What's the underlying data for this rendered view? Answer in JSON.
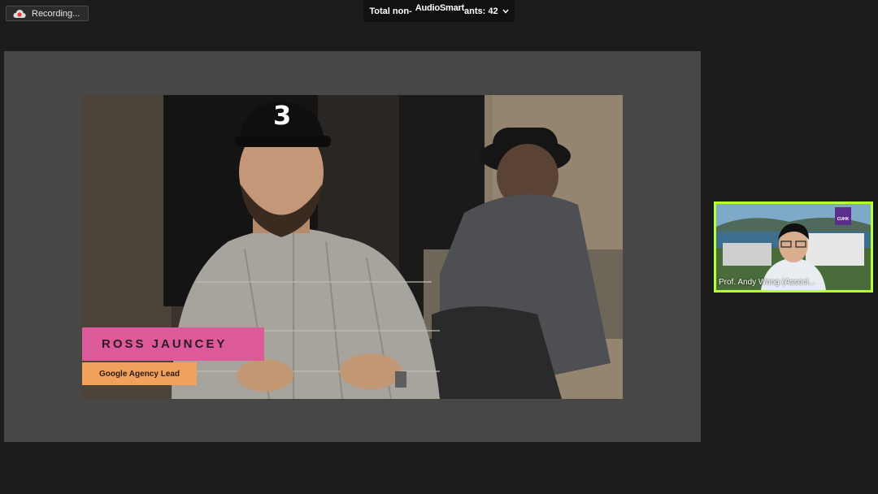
{
  "recording": {
    "label": "Recording..."
  },
  "top_bar": {
    "participants_prefix": "Total non-",
    "brand": "AudioSmart",
    "participants_suffix": "ants: 42"
  },
  "video": {
    "name": "ROSS JAUNCEY",
    "role": "Google Agency Lead",
    "cap_number": "3"
  },
  "participant": {
    "name": "Prof. Andy Wong (Associ...",
    "logo_text": "CUHK"
  },
  "colors": {
    "accent_border": "#b6ff3b",
    "name_plate": "#dd5a9a",
    "role_plate": "#f0a25c"
  }
}
